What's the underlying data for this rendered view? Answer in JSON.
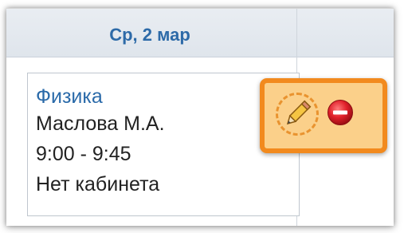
{
  "day_header": {
    "title": "Ср, 2 мар"
  },
  "lesson": {
    "subject": "Физика",
    "teacher": "Маслова М.А.",
    "time": "9:00 - 9:45",
    "room": "Нет кабинета"
  },
  "actions": {
    "edit_icon": "pencil-icon",
    "delete_icon": "delete-circle-icon"
  },
  "colors": {
    "header_text": "#2d6aa8",
    "subject_text": "#2a6aa9",
    "highlight_border": "#f28a1e",
    "highlight_fill": "#fbd08a",
    "delete_red": "#e0202a"
  }
}
